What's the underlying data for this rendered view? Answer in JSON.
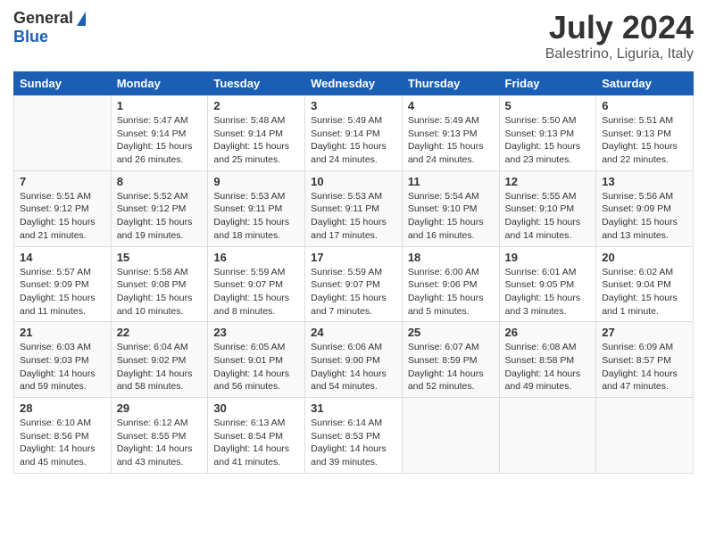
{
  "header": {
    "logo_general": "General",
    "logo_blue": "Blue",
    "month_year": "July 2024",
    "location": "Balestrino, Liguria, Italy"
  },
  "weekdays": [
    "Sunday",
    "Monday",
    "Tuesday",
    "Wednesday",
    "Thursday",
    "Friday",
    "Saturday"
  ],
  "weeks": [
    [
      {
        "day": null,
        "info": null
      },
      {
        "day": "1",
        "info": "Sunrise: 5:47 AM\nSunset: 9:14 PM\nDaylight: 15 hours\nand 26 minutes."
      },
      {
        "day": "2",
        "info": "Sunrise: 5:48 AM\nSunset: 9:14 PM\nDaylight: 15 hours\nand 25 minutes."
      },
      {
        "day": "3",
        "info": "Sunrise: 5:49 AM\nSunset: 9:14 PM\nDaylight: 15 hours\nand 24 minutes."
      },
      {
        "day": "4",
        "info": "Sunrise: 5:49 AM\nSunset: 9:13 PM\nDaylight: 15 hours\nand 24 minutes."
      },
      {
        "day": "5",
        "info": "Sunrise: 5:50 AM\nSunset: 9:13 PM\nDaylight: 15 hours\nand 23 minutes."
      },
      {
        "day": "6",
        "info": "Sunrise: 5:51 AM\nSunset: 9:13 PM\nDaylight: 15 hours\nand 22 minutes."
      }
    ],
    [
      {
        "day": "7",
        "info": "Sunrise: 5:51 AM\nSunset: 9:12 PM\nDaylight: 15 hours\nand 21 minutes."
      },
      {
        "day": "8",
        "info": "Sunrise: 5:52 AM\nSunset: 9:12 PM\nDaylight: 15 hours\nand 19 minutes."
      },
      {
        "day": "9",
        "info": "Sunrise: 5:53 AM\nSunset: 9:11 PM\nDaylight: 15 hours\nand 18 minutes."
      },
      {
        "day": "10",
        "info": "Sunrise: 5:53 AM\nSunset: 9:11 PM\nDaylight: 15 hours\nand 17 minutes."
      },
      {
        "day": "11",
        "info": "Sunrise: 5:54 AM\nSunset: 9:10 PM\nDaylight: 15 hours\nand 16 minutes."
      },
      {
        "day": "12",
        "info": "Sunrise: 5:55 AM\nSunset: 9:10 PM\nDaylight: 15 hours\nand 14 minutes."
      },
      {
        "day": "13",
        "info": "Sunrise: 5:56 AM\nSunset: 9:09 PM\nDaylight: 15 hours\nand 13 minutes."
      }
    ],
    [
      {
        "day": "14",
        "info": "Sunrise: 5:57 AM\nSunset: 9:09 PM\nDaylight: 15 hours\nand 11 minutes."
      },
      {
        "day": "15",
        "info": "Sunrise: 5:58 AM\nSunset: 9:08 PM\nDaylight: 15 hours\nand 10 minutes."
      },
      {
        "day": "16",
        "info": "Sunrise: 5:59 AM\nSunset: 9:07 PM\nDaylight: 15 hours\nand 8 minutes."
      },
      {
        "day": "17",
        "info": "Sunrise: 5:59 AM\nSunset: 9:07 PM\nDaylight: 15 hours\nand 7 minutes."
      },
      {
        "day": "18",
        "info": "Sunrise: 6:00 AM\nSunset: 9:06 PM\nDaylight: 15 hours\nand 5 minutes."
      },
      {
        "day": "19",
        "info": "Sunrise: 6:01 AM\nSunset: 9:05 PM\nDaylight: 15 hours\nand 3 minutes."
      },
      {
        "day": "20",
        "info": "Sunrise: 6:02 AM\nSunset: 9:04 PM\nDaylight: 15 hours\nand 1 minute."
      }
    ],
    [
      {
        "day": "21",
        "info": "Sunrise: 6:03 AM\nSunset: 9:03 PM\nDaylight: 14 hours\nand 59 minutes."
      },
      {
        "day": "22",
        "info": "Sunrise: 6:04 AM\nSunset: 9:02 PM\nDaylight: 14 hours\nand 58 minutes."
      },
      {
        "day": "23",
        "info": "Sunrise: 6:05 AM\nSunset: 9:01 PM\nDaylight: 14 hours\nand 56 minutes."
      },
      {
        "day": "24",
        "info": "Sunrise: 6:06 AM\nSunset: 9:00 PM\nDaylight: 14 hours\nand 54 minutes."
      },
      {
        "day": "25",
        "info": "Sunrise: 6:07 AM\nSunset: 8:59 PM\nDaylight: 14 hours\nand 52 minutes."
      },
      {
        "day": "26",
        "info": "Sunrise: 6:08 AM\nSunset: 8:58 PM\nDaylight: 14 hours\nand 49 minutes."
      },
      {
        "day": "27",
        "info": "Sunrise: 6:09 AM\nSunset: 8:57 PM\nDaylight: 14 hours\nand 47 minutes."
      }
    ],
    [
      {
        "day": "28",
        "info": "Sunrise: 6:10 AM\nSunset: 8:56 PM\nDaylight: 14 hours\nand 45 minutes."
      },
      {
        "day": "29",
        "info": "Sunrise: 6:12 AM\nSunset: 8:55 PM\nDaylight: 14 hours\nand 43 minutes."
      },
      {
        "day": "30",
        "info": "Sunrise: 6:13 AM\nSunset: 8:54 PM\nDaylight: 14 hours\nand 41 minutes."
      },
      {
        "day": "31",
        "info": "Sunrise: 6:14 AM\nSunset: 8:53 PM\nDaylight: 14 hours\nand 39 minutes."
      },
      {
        "day": null,
        "info": null
      },
      {
        "day": null,
        "info": null
      },
      {
        "day": null,
        "info": null
      }
    ]
  ]
}
